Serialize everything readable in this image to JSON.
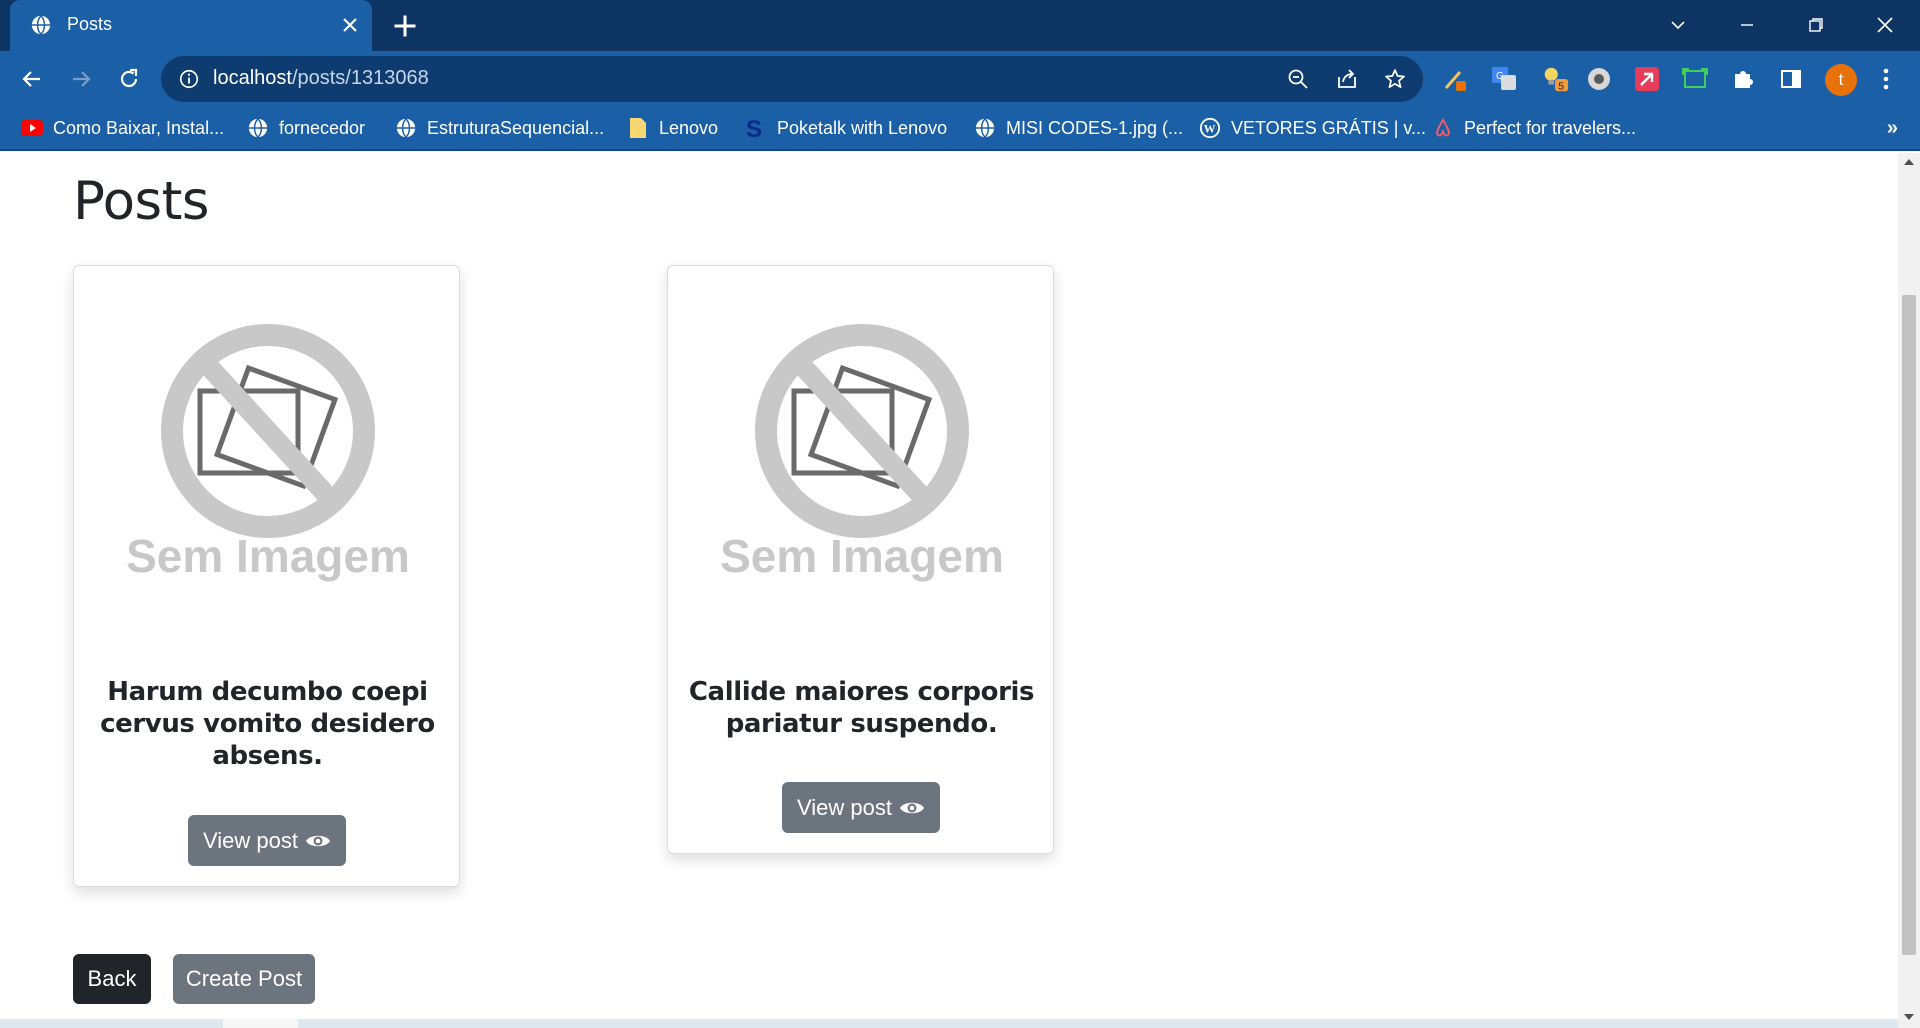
{
  "browser": {
    "tab_title": "Posts",
    "url_host": "localhost",
    "url_path": "/posts/1313068",
    "avatar_letter": "t",
    "ext_badge_count": "5",
    "bookmarks": [
      {
        "label": "Como Baixar, Instal...",
        "icon": "youtube-icon"
      },
      {
        "label": "fornecedor",
        "icon": "globe-icon"
      },
      {
        "label": "EstruturaSequencial...",
        "icon": "globe-icon"
      },
      {
        "label": "Lenovo",
        "icon": "folder-icon"
      },
      {
        "label": "Poketalk with Lenovo",
        "icon": "s-logo-icon"
      },
      {
        "label": "MISI CODES-1.jpg (...",
        "icon": "globe-icon"
      },
      {
        "label": "VETORES GRÁTIS | v...",
        "icon": "wordpress-icon"
      },
      {
        "label": "Perfect for travelers...",
        "icon": "airbnb-icon"
      }
    ],
    "more_bookmarks": "»"
  },
  "page": {
    "title": "Posts",
    "posts": [
      {
        "image_text": "Sem Imagem",
        "title": "Harum decumbo coepi cervus vomito desidero absens.",
        "button_label": "View post"
      },
      {
        "image_text": "Sem Imagem",
        "title": "Callide maiores corporis pariatur suspendo.",
        "button_label": "View post"
      }
    ],
    "back_label": "Back",
    "create_label": "Create Post"
  },
  "colors": {
    "tabbar": "#0d3462",
    "toolbar": "#1b5fa6",
    "omnibox": "#0f3c70",
    "button_secondary": "#6c757d",
    "button_dark": "#212529",
    "placeholder_gray": "#c8c8c8",
    "avatar": "#e8710a"
  }
}
